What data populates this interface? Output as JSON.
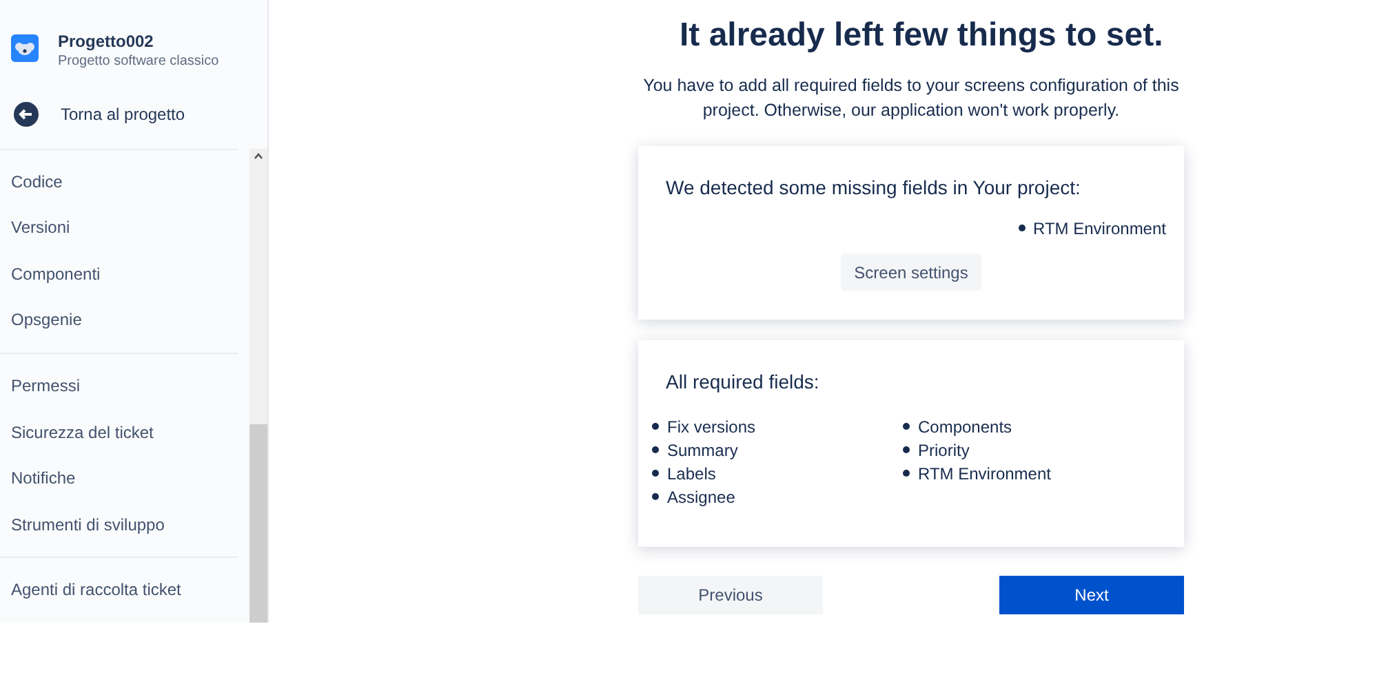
{
  "project": {
    "name": "Progetto002",
    "type": "Progetto software classico"
  },
  "back_link": "Torna al progetto",
  "sidebar_groups": [
    {
      "items": [
        "Codice",
        "Versioni",
        "Componenti",
        "Opsgenie"
      ]
    },
    {
      "items": [
        "Permessi",
        "Sicurezza del ticket",
        "Notifiche",
        "Strumenti di sviluppo"
      ]
    },
    {
      "items": [
        "Agenti di raccolta ticket"
      ]
    }
  ],
  "title": "It already left few things to set.",
  "description": "You have to add all required fields to your screens configuration of this project. Otherwise, our application won't work properly.",
  "missing_card": {
    "heading": "We detected some missing fields in Your project:",
    "fields": [
      "RTM Environment"
    ],
    "button": "Screen settings"
  },
  "required_card": {
    "heading": "All required fields:",
    "column_1": [
      "Fix versions",
      "Summary",
      "Labels",
      "Assignee"
    ],
    "column_2": [
      "Components",
      "Priority",
      "RTM Environment"
    ]
  },
  "buttons": {
    "previous": "Previous",
    "next": "Next"
  }
}
